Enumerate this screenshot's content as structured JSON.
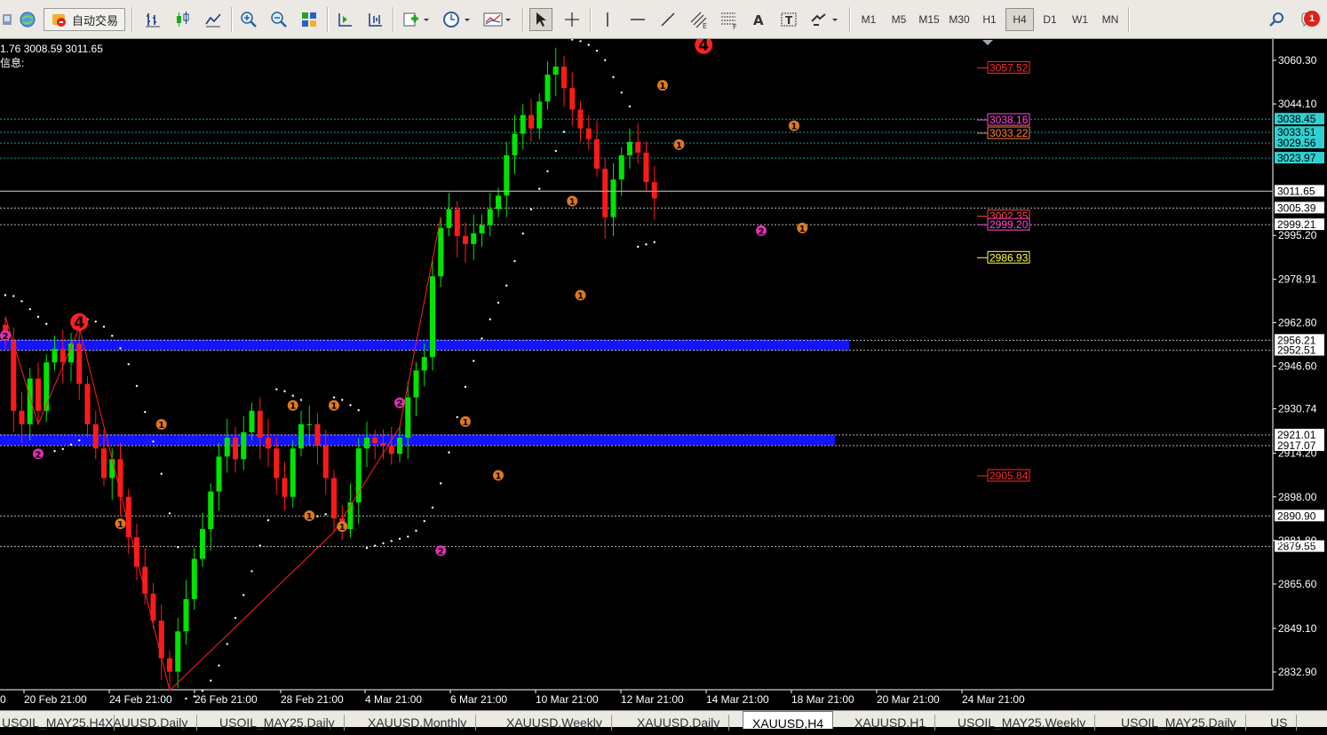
{
  "toolbar": {
    "auto_trading_label": "自动交易",
    "periods": [
      "M1",
      "M5",
      "M15",
      "M30",
      "H1",
      "H4",
      "D1",
      "W1",
      "MN"
    ],
    "active_period": "H4",
    "notification_count": "1"
  },
  "chart_info": {
    "ohlc_line": "1.76 3008.59 3011.65",
    "info_label": "信息:"
  },
  "chart_data": {
    "type": "candlestick",
    "symbol": "XAUUSD",
    "timeframe": "H4",
    "ylim": [
      2822,
      3072
    ],
    "y_ticks": [
      3060.3,
      3044.1,
      3011.65,
      2995.2,
      2978.91,
      2962.8,
      2946.6,
      2930.74,
      2914.2,
      2898.0,
      2881.8,
      2865.6,
      2849.1,
      2832.9
    ],
    "x_ticks": [
      "20 Feb 21:00",
      "24 Feb 21:00",
      "26 Feb 21:00",
      "28 Feb 21:00",
      "4 Mar 21:00",
      "6 Mar 21:00",
      "10 Mar 21:00",
      "12 Mar 21:00",
      "14 Mar 21:00",
      "18 Mar 21:00",
      "20 Mar 21:00",
      "24 Mar 21:00"
    ],
    "x_tick_partial": "0",
    "current_price": 3011.65,
    "price_labels": [
      {
        "price": 3038.45,
        "style": "teal"
      },
      {
        "price": 3033.51,
        "style": "teal"
      },
      {
        "price": 3029.56,
        "style": "teal"
      },
      {
        "price": 3023.97,
        "style": "teal"
      },
      {
        "price": 3011.65,
        "style": "white"
      },
      {
        "price": 3005.39,
        "style": "white"
      },
      {
        "price": 2999.21,
        "style": "white"
      },
      {
        "price": 2956.21,
        "style": "white"
      },
      {
        "price": 2952.51,
        "style": "white"
      },
      {
        "price": 2921.01,
        "style": "white"
      },
      {
        "price": 2917.07,
        "style": "white"
      },
      {
        "price": 2890.9,
        "style": "white"
      },
      {
        "price": 2879.55,
        "style": "white"
      }
    ],
    "level_tags": [
      {
        "price": 3057.52,
        "color": "#ff2a2a"
      },
      {
        "price": 3038.16,
        "color": "#ff4fd2"
      },
      {
        "price": 3033.22,
        "color": "#ff8040"
      },
      {
        "price": 3002.35,
        "color": "#ff4040"
      },
      {
        "price": 2999.2,
        "color": "#ff4fd2"
      },
      {
        "price": 2986.93,
        "color": "#ffff40"
      },
      {
        "price": 2905.84,
        "color": "#ff2a2a"
      }
    ],
    "zones": [
      {
        "top": 2956.5,
        "bottom": 2952.5,
        "color": "#1414ff"
      },
      {
        "top": 2921.2,
        "bottom": 2917.2,
        "color": "#1414ff"
      }
    ],
    "closes": [
      2956,
      2930,
      2925,
      2942,
      2930,
      2948,
      2953,
      2948,
      2955,
      2940,
      2925,
      2916,
      2905,
      2912,
      2898,
      2883,
      2872,
      2862,
      2852,
      2838,
      2833,
      2848,
      2860,
      2875,
      2886,
      2900,
      2913,
      2920,
      2912,
      2922,
      2930,
      2920,
      2916,
      2905,
      2898,
      2916,
      2925,
      2925,
      2917,
      2905,
      2890,
      2886,
      2896,
      2916,
      2920,
      2918,
      2917,
      2914,
      2920,
      2935,
      2945,
      2950,
      2980,
      2998,
      3005,
      2995,
      2992,
      2996,
      2999,
      3005,
      3010,
      3025,
      3033,
      3040,
      3035,
      3045,
      3055,
      3058,
      3050,
      3042,
      3035,
      3031,
      3020,
      3002,
      3016,
      3025,
      3030,
      3026,
      3015,
      3009
    ],
    "wave_labels": [
      {
        "text": "2",
        "i": 0,
        "price": 2958,
        "color": "#e030b0"
      },
      {
        "text": "4",
        "i": 9,
        "price": 2963,
        "color": "#ff2020",
        "big": true
      },
      {
        "text": "2",
        "i": 4,
        "price": 2914,
        "color": "#e030b0"
      },
      {
        "text": "1",
        "i": 19,
        "price": 2925,
        "color": "#e07820"
      },
      {
        "text": "1",
        "i": 14,
        "price": 2888,
        "color": "#e07820"
      },
      {
        "text": "1",
        "i": 35,
        "price": 2932,
        "color": "#e07820"
      },
      {
        "text": "1",
        "i": 40,
        "price": 2932,
        "color": "#e07820"
      },
      {
        "text": "2",
        "i": 48,
        "price": 2933,
        "color": "#e030b0"
      },
      {
        "text": "1",
        "i": 37,
        "price": 2891,
        "color": "#e07820"
      },
      {
        "text": "1",
        "i": 41,
        "price": 2887,
        "color": "#e07820"
      },
      {
        "text": "2",
        "i": 53,
        "price": 2878,
        "color": "#e030b0"
      },
      {
        "text": "1",
        "i": 56,
        "price": 2926,
        "color": "#e07820"
      },
      {
        "text": "1",
        "i": 60,
        "price": 2906,
        "color": "#e07820"
      },
      {
        "text": "1",
        "i": 69,
        "price": 3008,
        "color": "#e07820"
      },
      {
        "text": "1",
        "i": 70,
        "price": 2973,
        "color": "#e07820"
      },
      {
        "text": "1",
        "i": 80,
        "price": 3051,
        "color": "#e07820"
      },
      {
        "text": "1",
        "i": 82,
        "price": 3029,
        "color": "#e07820"
      },
      {
        "text": "4",
        "i": 85,
        "price": 3066,
        "color": "#ff2020",
        "big": true
      },
      {
        "text": "2",
        "i": 92,
        "price": 2997,
        "color": "#e030b0"
      },
      {
        "text": "1",
        "i": 96,
        "price": 3036,
        "color": "#e07820"
      },
      {
        "text": "1",
        "i": 97,
        "price": 2998,
        "color": "#e07820"
      }
    ]
  },
  "tabs": [
    {
      "label": "USOIL_MAY25,H4"
    },
    {
      "label": "XAUUSD,Daily"
    },
    {
      "label": "USOIL_MAY25,Daily"
    },
    {
      "label": "XAUUSD,Monthly"
    },
    {
      "label": "XAUUSD,Weekly"
    },
    {
      "label": "XAUUSD,Daily"
    },
    {
      "label": "XAUUSD,H4",
      "active": true
    },
    {
      "label": "XAUUSD,H1"
    },
    {
      "label": "USOIL_MAY25,Weekly"
    },
    {
      "label": "USOIL_MAY25,Daily"
    },
    {
      "label": "US"
    }
  ],
  "colors": {
    "bull": "#00e400",
    "bear": "#ff1a1a",
    "zigzag": "#ff2020",
    "psar": "#ffffff",
    "grid_dotted": "#c8c8c8",
    "teal_label": "#30d0d0"
  }
}
